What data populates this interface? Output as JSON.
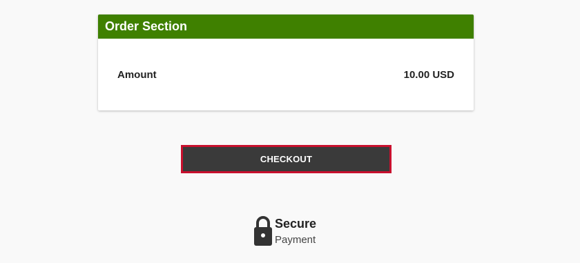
{
  "order": {
    "header_title": "Order Section",
    "amount_label": "Amount",
    "amount_value": "10.00 USD",
    "header_color": "#3f8000"
  },
  "checkout": {
    "label": "CHECKOUT",
    "border_color": "#c8102e",
    "background_color": "#3a3a3a"
  },
  "secure": {
    "icon": "lock-icon",
    "title": "Secure",
    "subtitle": "Payment"
  }
}
